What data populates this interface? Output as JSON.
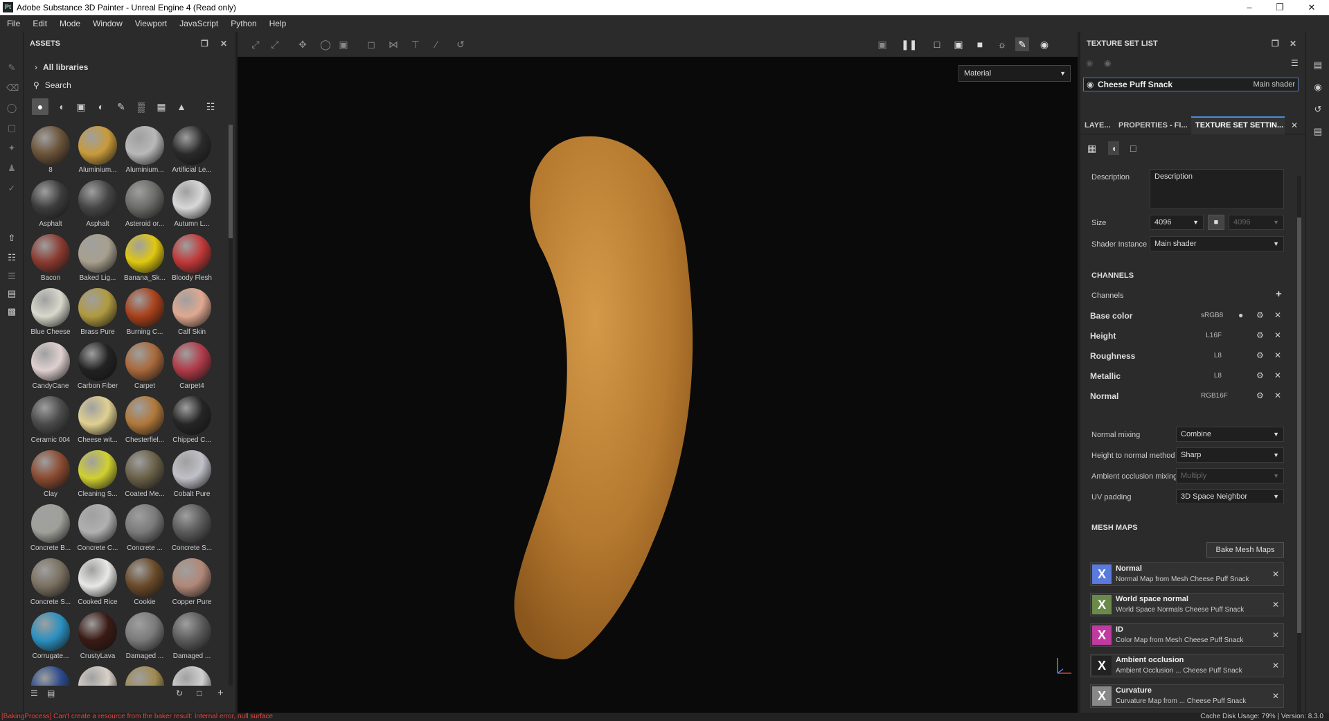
{
  "window": {
    "title": "Adobe Substance 3D Painter - Unreal Engine 4 (Read only)",
    "app_icon": "Pt"
  },
  "menu": [
    "File",
    "Edit",
    "Mode",
    "Window",
    "Viewport",
    "JavaScript",
    "Python",
    "Help"
  ],
  "assets": {
    "title": "ASSETS",
    "all_libraries": "All libraries",
    "search_placeholder": "Search",
    "items": [
      {
        "name": "8",
        "color": "#6a5238"
      },
      {
        "name": "Aluminium...",
        "color": "#c89a3a"
      },
      {
        "name": "Aluminium...",
        "color": "#b8b8b8"
      },
      {
        "name": "Artificial Le...",
        "color": "#2a2a2a"
      },
      {
        "name": "Asphalt",
        "color": "#3c3c3c"
      },
      {
        "name": "Asphalt",
        "color": "#454545"
      },
      {
        "name": "Asteroid or...",
        "color": "#6a6a66"
      },
      {
        "name": "Autumn L...",
        "color": "#d8d8d8"
      },
      {
        "name": "Bacon",
        "color": "#8a3a30"
      },
      {
        "name": "Baked Lig...",
        "color": "#a8a08e"
      },
      {
        "name": "Banana_Sk...",
        "color": "#e0c810"
      },
      {
        "name": "Bloody Flesh",
        "color": "#c03838"
      },
      {
        "name": "Blue Cheese",
        "color": "#d8d8cc"
      },
      {
        "name": "Brass Pure",
        "color": "#b09a40"
      },
      {
        "name": "Burning C...",
        "color": "#a8401a"
      },
      {
        "name": "Calf Skin",
        "color": "#e0a890"
      },
      {
        "name": "CandyCane",
        "color": "#e0d0d0"
      },
      {
        "name": "Carbon Fiber",
        "color": "#222222"
      },
      {
        "name": "Carpet",
        "color": "#a8683a"
      },
      {
        "name": "Carpet4",
        "color": "#b03a48"
      },
      {
        "name": "Ceramic 004",
        "color": "#4a4a4a"
      },
      {
        "name": "Cheese wit...",
        "color": "#e0d090"
      },
      {
        "name": "Chesterfiel...",
        "color": "#b0783a"
      },
      {
        "name": "Chipped C...",
        "color": "#252525"
      },
      {
        "name": "Clay",
        "color": "#8a4a30"
      },
      {
        "name": "Cleaning S...",
        "color": "#d0d030"
      },
      {
        "name": "Coated Me...",
        "color": "#6a6048"
      },
      {
        "name": "Cobalt Pure",
        "color": "#c0c0c8"
      },
      {
        "name": "Concrete B...",
        "color": "#a0a09a"
      },
      {
        "name": "Concrete C...",
        "color": "#b0b0b0"
      },
      {
        "name": "Concrete ...",
        "color": "#7a7a7a"
      },
      {
        "name": "Concrete S...",
        "color": "#5a5a5a"
      },
      {
        "name": "Concrete S...",
        "color": "#7a7060"
      },
      {
        "name": "Cooked Rice",
        "color": "#e8e8e4"
      },
      {
        "name": "Cookie",
        "color": "#6a4a28"
      },
      {
        "name": "Copper Pure",
        "color": "#b08878"
      },
      {
        "name": "Corrugate...",
        "color": "#2a90c0"
      },
      {
        "name": "CrustyLava",
        "color": "#3a1a14"
      },
      {
        "name": "Damaged ...",
        "color": "#7a7a7a"
      },
      {
        "name": "Damaged ...",
        "color": "#5a5a5a"
      },
      {
        "name": "",
        "color": "#2a4a8a"
      },
      {
        "name": "",
        "color": "#d8d0c8"
      },
      {
        "name": "",
        "color": "#a08a50"
      },
      {
        "name": "",
        "color": "#d0d0d0"
      }
    ]
  },
  "viewport": {
    "material_select": "Material"
  },
  "texture_set_list": {
    "title": "TEXTURE SET LIST",
    "set_name": "Cheese Puff Snack",
    "shader": "Main shader"
  },
  "tabs": [
    "LAYE...",
    "PROPERTIES - FI...",
    "TEXTURE SET SETTIN..."
  ],
  "settings": {
    "description_label": "Description",
    "description_value": "Description",
    "size_label": "Size",
    "size_value": "4096",
    "size_value2": "4096",
    "shader_instance_label": "Shader Instance",
    "shader_instance_value": "Main shader",
    "channels_section": "CHANNELS",
    "channels_label": "Channels",
    "channels": [
      {
        "name": "Base color",
        "format": "sRGB8"
      },
      {
        "name": "Height",
        "format": "L16F"
      },
      {
        "name": "Roughness",
        "format": "L8"
      },
      {
        "name": "Metallic",
        "format": "L8"
      },
      {
        "name": "Normal",
        "format": "RGB16F"
      }
    ],
    "normal_mixing_label": "Normal mixing",
    "normal_mixing_value": "Combine",
    "height_to_normal_label": "Height to normal method",
    "height_to_normal_value": "Sharp",
    "ao_mixing_label": "Ambient occlusion mixing",
    "ao_mixing_value": "Multiply",
    "uv_padding_label": "UV padding",
    "uv_padding_value": "3D Space Neighbor",
    "mesh_maps_section": "MESH MAPS",
    "bake_button": "Bake Mesh Maps",
    "mesh_maps": [
      {
        "name": "Normal",
        "desc": "Normal Map from Mesh Cheese Puff Snack",
        "color": "#5a7adc"
      },
      {
        "name": "World space normal",
        "desc": "World Space Normals Cheese Puff Snack",
        "color": "#6a8a4a"
      },
      {
        "name": "ID",
        "desc": "Color Map from Mesh Cheese Puff Snack",
        "color": "#c03aa0"
      },
      {
        "name": "Ambient occlusion",
        "desc": "Ambient Occlusion ... Cheese Puff Snack",
        "color": "#222222"
      },
      {
        "name": "Curvature",
        "desc": "Curvature Map from ... Cheese Puff Snack",
        "color": "#888888"
      }
    ]
  },
  "status": {
    "error": "[BakingProcess] Can't create a resource from the baker result: Internal error, null surface",
    "cache": "Cache Disk Usage:",
    "cache_pct": "79%",
    "version": "Version: 8.3.0"
  }
}
